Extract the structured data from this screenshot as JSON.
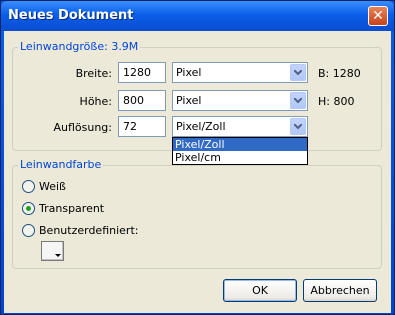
{
  "window": {
    "title": "Neues Dokument"
  },
  "canvas_group": {
    "legend": "Leinwandgröße: 3.9M",
    "width": {
      "label": "Breite:",
      "value": "1280",
      "unit": "Pixel",
      "info": "B: 1280"
    },
    "height": {
      "label": "Höhe:",
      "value": "800",
      "unit": "Pixel",
      "info": "H: 800"
    },
    "resolution": {
      "label": "Auflösung:",
      "value": "72",
      "unit": "Pixel/Zoll",
      "options": [
        "Pixel/Zoll",
        "Pixel/cm"
      ],
      "highlighted_option": "Pixel/Zoll"
    }
  },
  "color_group": {
    "legend": "Leinwandfarbe",
    "options": [
      {
        "label": "Weiß",
        "checked": false
      },
      {
        "label": "Transparent",
        "checked": true
      },
      {
        "label": "Benutzerdefiniert:",
        "checked": false
      }
    ]
  },
  "buttons": {
    "ok": "OK",
    "cancel": "Abbrechen"
  },
  "colors": {
    "accent": "#0046d5",
    "selection": "#316ac5",
    "radio_dot": "#21a121"
  }
}
